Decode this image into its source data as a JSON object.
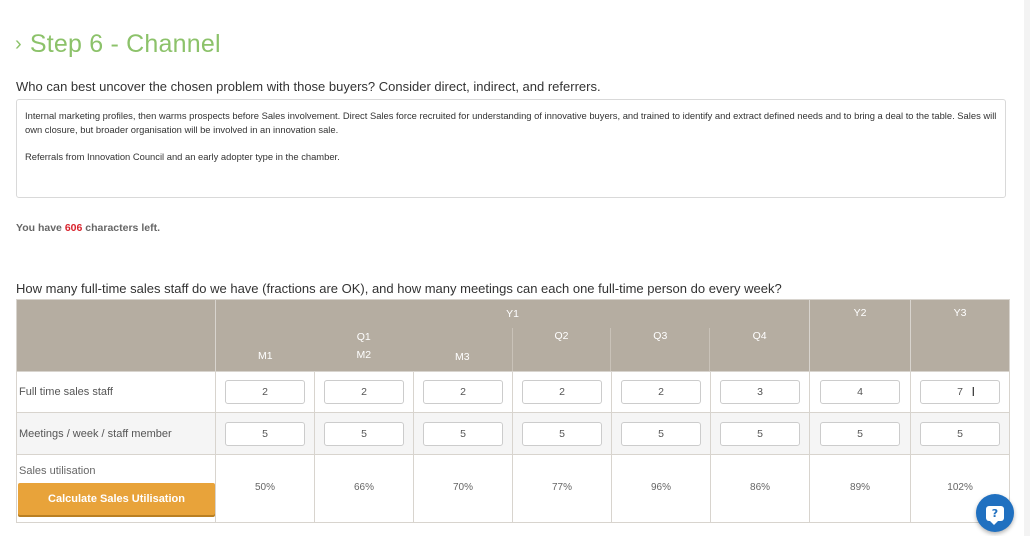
{
  "header": {
    "chevron": "›",
    "title": "Step 6 - Channel"
  },
  "channel": {
    "question": "Who can best uncover the chosen problem with those buyers? Consider direct, indirect, and referrers.",
    "answer_p1": "Internal marketing profiles, then warms prospects before Sales involvement. Direct Sales force recruited for understanding of innovative buyers, and trained to identify and extract defined needs and to bring a deal to the table. Sales will own closure, but broader organisation will be involved in an innovation sale.",
    "answer_p2": "Referrals from Innovation Council and an early adopter type in the chamber.",
    "chars_prefix": "You have ",
    "chars_count": "606",
    "chars_suffix": " characters left."
  },
  "staffing": {
    "question": "How many full-time sales staff do we have (fractions are OK), and how many meetings can each one full-time person do every week?",
    "headers": {
      "y1": "Y1",
      "q1": "Q1",
      "q2": "Q2",
      "q3": "Q3",
      "q4": "Q4",
      "m1": "M1",
      "m2": "M2",
      "m3": "M3",
      "y2": "Y2",
      "y3": "Y3"
    },
    "rows": {
      "staff_label": "Full time sales staff",
      "staff": [
        "2",
        "2",
        "2",
        "2",
        "2",
        "3",
        "4",
        "7"
      ],
      "meetings_label": "Meetings / week / staff member",
      "meetings": [
        "5",
        "5",
        "5",
        "5",
        "5",
        "5",
        "5",
        "5"
      ],
      "util_label": "Sales utilisation",
      "util": [
        "50%",
        "66%",
        "70%",
        "77%",
        "96%",
        "86%",
        "89%",
        "102%"
      ]
    },
    "calc_button": "Calculate Sales Utilisation"
  },
  "colors": {
    "title_green": "#8cc26a",
    "header_taupe": "#b5ada1",
    "button_orange": "#e8a33a",
    "chars_red": "#d9232d",
    "help_blue": "#2070c0"
  },
  "help": {
    "glyph": "?"
  }
}
